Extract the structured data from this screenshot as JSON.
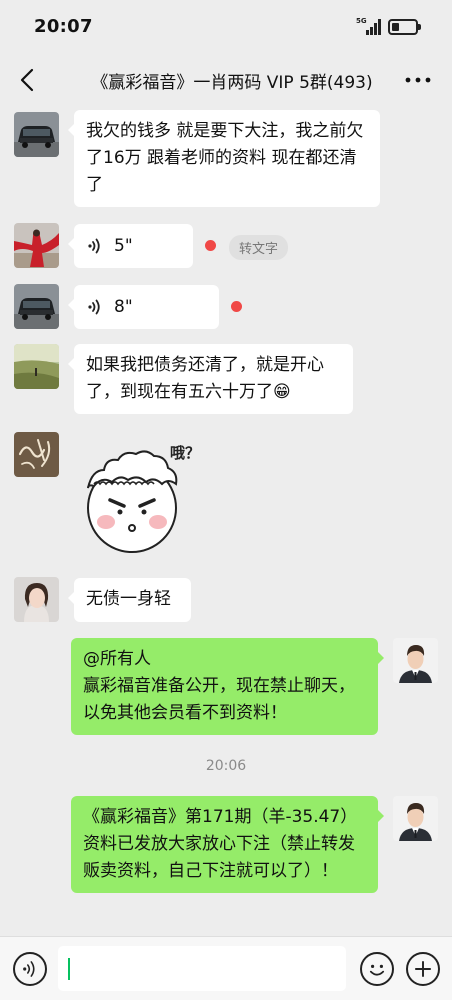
{
  "status_bar": {
    "time": "20:07",
    "network": "5G"
  },
  "nav": {
    "title": "《赢彩福音》一肖两码 VIP 5群(493)"
  },
  "messages": [
    {
      "type": "text",
      "side": "left",
      "avatar": "car-avatar",
      "text": "我欠的钱多 就是要下大注，我之前欠了16万 跟着老师的资料 现在都还清了"
    },
    {
      "type": "voice",
      "side": "left",
      "avatar": "woman-red-dress-avatar",
      "duration": "5\"",
      "unread": true,
      "action": "转文字"
    },
    {
      "type": "voice",
      "side": "left",
      "avatar": "car-avatar",
      "duration": "8\"",
      "unread": true
    },
    {
      "type": "text",
      "side": "left",
      "avatar": "landscape-avatar",
      "text": "如果我把债务还清了，就是开心了，到现在有五六十万了😁"
    },
    {
      "type": "sticker",
      "side": "left",
      "avatar": "calligraphy-avatar",
      "caption": "哦？"
    },
    {
      "type": "text",
      "side": "left",
      "avatar": "woman-portrait-avatar",
      "text": "无债一身轻"
    },
    {
      "type": "text",
      "side": "right",
      "avatar": "man-suit-avatar",
      "line1": "@所有人",
      "line2": "赢彩福音准备公开，现在禁止聊天，以免其他会员看不到资料！"
    },
    {
      "type": "time",
      "text": "20:06"
    },
    {
      "type": "text",
      "side": "right",
      "avatar": "man-suit-avatar",
      "text": "《赢彩福音》第171期（羊-35.47）资料已发放大家放心下注（禁止转发贩卖资料，自己下注就可以了）！"
    }
  ],
  "input": {
    "value": "",
    "placeholder": ""
  },
  "colors": {
    "background": "#ededed",
    "bubble_self": "#95ec69",
    "bubble_other": "#ffffff",
    "unread_dot": "#f04846",
    "caret": "#07c160"
  }
}
